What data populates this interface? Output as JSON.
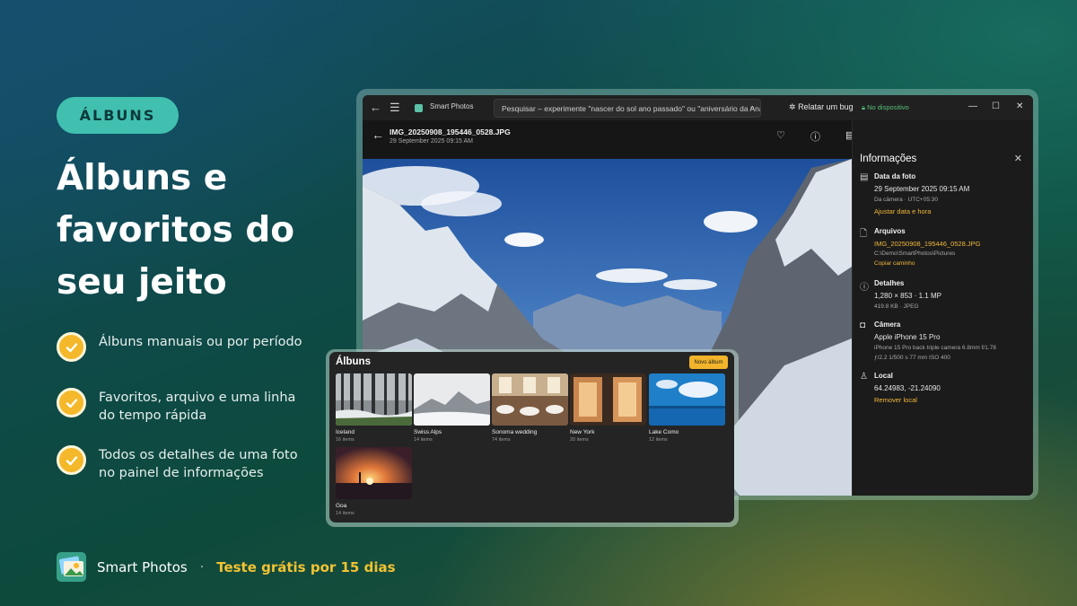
{
  "marketing": {
    "badge": "ÁLBUNS",
    "headline": "Álbuns e favoritos do seu jeito",
    "features": [
      "Álbuns manuais ou por período",
      "Favoritos, arquivo e uma linha do tempo rápida",
      "Todos os detalhes de uma foto no painel de informações"
    ],
    "footer": {
      "app_name": "Smart Photos",
      "separator": "·",
      "trial": "Teste grátis por 15 dias"
    },
    "colors": {
      "accent_teal": "#41c0b0",
      "accent_gold": "#f4b82a"
    }
  },
  "window": {
    "title": "Smart Photos",
    "search_placeholder": "Pesquisar – experimente \"nascer do sol ano passado\" ou \"aniversário da Ana\"",
    "report_bug": "Relatar um bug",
    "device_status": "No dispositivo",
    "file": {
      "name": "IMG_20250908_195446_0528.JPG",
      "date": "29 September 2025 09:15 AM"
    },
    "toolbar_icons": [
      "heart-icon",
      "info-icon",
      "details-icon",
      "plus-icon",
      "share-icon",
      "edit-icon",
      "delete-icon",
      "more-icon"
    ]
  },
  "info": {
    "title": "Informações",
    "photo_date": {
      "heading": "Data da foto",
      "value": "29 September 2025 09:15 AM",
      "sub": "Da câmera · UTC+05:30",
      "link": "Ajustar data e hora"
    },
    "files": {
      "heading": "Arquivos",
      "name": "IMG_20250908_195446_0528.JPG",
      "path": "C:\\Demo\\SmartPhotos\\Pictures",
      "link": "Copiar caminho"
    },
    "details": {
      "heading": "Detalhes",
      "value": "1,280 × 853 · 1.1 MP",
      "sub": "419.8 KB · JPEG"
    },
    "camera": {
      "heading": "Câmera",
      "value": "Apple iPhone 15 Pro",
      "lens": "iPhone 15 Pro back triple camera 6.8mm f/1.78",
      "exposure": "ƒ/2.2   1/500 s   77 mm   ISO 400"
    },
    "location": {
      "heading": "Local",
      "value": "64.24983, -21.24090",
      "link": "Remover local"
    }
  },
  "albums": {
    "title": "Álbuns",
    "new_button": "Novo álbum",
    "items": [
      {
        "name": "Iceland",
        "count": "16 items"
      },
      {
        "name": "Swiss Alps",
        "count": "14 items"
      },
      {
        "name": "Sonoma wedding",
        "count": "74 items"
      },
      {
        "name": "New York",
        "count": "20 items"
      },
      {
        "name": "Lake Como",
        "count": "12 items"
      },
      {
        "name": "Goa",
        "count": "14 items"
      }
    ]
  }
}
